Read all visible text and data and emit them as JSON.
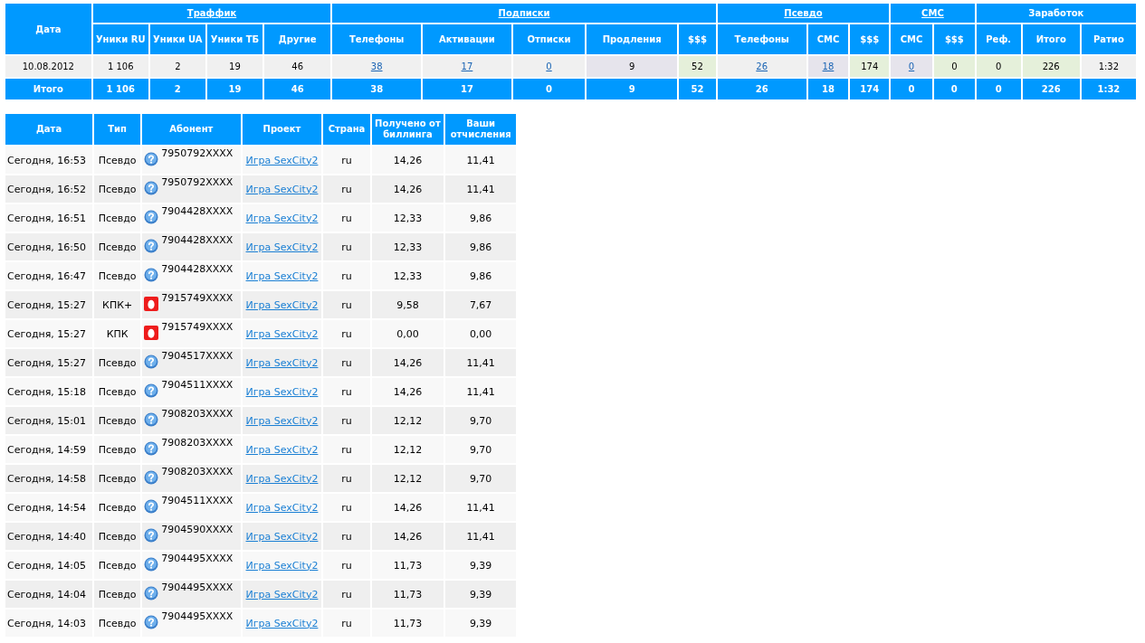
{
  "summary": {
    "groups": [
      {
        "label": "Дата",
        "link": false
      },
      {
        "label": "Траффик",
        "link": true,
        "columns": [
          "Уники RU",
          "Уники UA",
          "Уники ТБ",
          "Другие"
        ]
      },
      {
        "label": "Подписки",
        "link": true,
        "columns": [
          "Телефоны",
          "Активации",
          "Отписки",
          "Продления",
          "$$$"
        ]
      },
      {
        "label": "Псевдо",
        "link": true,
        "columns": [
          "Телефоны",
          "СМС",
          "$$$"
        ]
      },
      {
        "label": "СМС",
        "link": true,
        "columns": [
          "СМС",
          "$$$"
        ]
      },
      {
        "label": "Заработок",
        "link": false,
        "columns": [
          "Реф.",
          "Итого",
          "Ратио"
        ]
      }
    ],
    "row": [
      {
        "value": "10.08.2012",
        "link": false,
        "color": "#f0f0f0"
      },
      {
        "value": "1 106",
        "link": false,
        "color": "#f0f0f0"
      },
      {
        "value": "2",
        "link": false,
        "color": "#f0f0f0"
      },
      {
        "value": "19",
        "link": false,
        "color": "#f0f0f0"
      },
      {
        "value": "46",
        "link": false,
        "color": "#f0f0f0"
      },
      {
        "value": "38",
        "link": true,
        "color": "#f0f0f0"
      },
      {
        "value": "17",
        "link": true,
        "color": "#f0f0f0"
      },
      {
        "value": "0",
        "link": true,
        "color": "#f0f0f0"
      },
      {
        "value": "9",
        "link": false,
        "color": "#e6e4ec"
      },
      {
        "value": "52",
        "link": false,
        "color": "#e5f0da"
      },
      {
        "value": "26",
        "link": true,
        "color": "#f0f0f0"
      },
      {
        "value": "18",
        "link": true,
        "color": "#e6e4ec"
      },
      {
        "value": "174",
        "link": false,
        "color": "#e5f0da"
      },
      {
        "value": "0",
        "link": true,
        "color": "#e6e4ec"
      },
      {
        "value": "0",
        "link": false,
        "color": "#e5f0da"
      },
      {
        "value": "0",
        "link": false,
        "color": "#e5f0da"
      },
      {
        "value": "226",
        "link": false,
        "color": "#e5f0da"
      },
      {
        "value": "1:32",
        "link": false,
        "color": "#f0f0f0"
      }
    ],
    "total": [
      "Итого",
      "1 106",
      "2",
      "19",
      "46",
      "38",
      "17",
      "0",
      "9",
      "52",
      "26",
      "18",
      "174",
      "0",
      "0",
      "0",
      "226",
      "1:32"
    ]
  },
  "payments": {
    "columns": [
      "Дата",
      "Тип",
      "Абонент",
      "Проект",
      "Страна",
      "Получено от биллинга",
      "Ваши отчисления"
    ],
    "rows": [
      {
        "date": "Сегодня, 16:53",
        "type": "Псевдо",
        "kind": "question",
        "phone": "7950792XXXX",
        "project": "Игра SexCity2",
        "country": "ru",
        "billing": "14,26",
        "payout": "11,41"
      },
      {
        "date": "Сегодня, 16:52",
        "type": "Псевдо",
        "kind": "question",
        "phone": "7950792XXXX",
        "project": "Игра SexCity2",
        "country": "ru",
        "billing": "14,26",
        "payout": "11,41"
      },
      {
        "date": "Сегодня, 16:51",
        "type": "Псевдо",
        "kind": "question",
        "phone": "7904428XXXX",
        "project": "Игра SexCity2",
        "country": "ru",
        "billing": "12,33",
        "payout": "9,86"
      },
      {
        "date": "Сегодня, 16:50",
        "type": "Псевдо",
        "kind": "question",
        "phone": "7904428XXXX",
        "project": "Игра SexCity2",
        "country": "ru",
        "billing": "12,33",
        "payout": "9,86"
      },
      {
        "date": "Сегодня, 16:47",
        "type": "Псевдо",
        "kind": "question",
        "phone": "7904428XXXX",
        "project": "Игра SexCity2",
        "country": "ru",
        "billing": "12,33",
        "payout": "9,86"
      },
      {
        "date": "Сегодня, 15:27",
        "type": "КПК+",
        "kind": "egg",
        "phone": "7915749XXXX",
        "project": "Игра SexCity2",
        "country": "ru",
        "billing": "9,58",
        "payout": "7,67"
      },
      {
        "date": "Сегодня, 15:27",
        "type": "КПК",
        "kind": "egg",
        "phone": "7915749XXXX",
        "project": "Игра SexCity2",
        "country": "ru",
        "billing": "0,00",
        "payout": "0,00"
      },
      {
        "date": "Сегодня, 15:27",
        "type": "Псевдо",
        "kind": "question",
        "phone": "7904517XXXX",
        "project": "Игра SexCity2",
        "country": "ru",
        "billing": "14,26",
        "payout": "11,41"
      },
      {
        "date": "Сегодня, 15:18",
        "type": "Псевдо",
        "kind": "question",
        "phone": "7904511XXXX",
        "project": "Игра SexCity2",
        "country": "ru",
        "billing": "14,26",
        "payout": "11,41"
      },
      {
        "date": "Сегодня, 15:01",
        "type": "Псевдо",
        "kind": "question",
        "phone": "7908203XXXX",
        "project": "Игра SexCity2",
        "country": "ru",
        "billing": "12,12",
        "payout": "9,70"
      },
      {
        "date": "Сегодня, 14:59",
        "type": "Псевдо",
        "kind": "question",
        "phone": "7908203XXXX",
        "project": "Игра SexCity2",
        "country": "ru",
        "billing": "12,12",
        "payout": "9,70"
      },
      {
        "date": "Сегодня, 14:58",
        "type": "Псевдо",
        "kind": "question",
        "phone": "7908203XXXX",
        "project": "Игра SexCity2",
        "country": "ru",
        "billing": "12,12",
        "payout": "9,70"
      },
      {
        "date": "Сегодня, 14:54",
        "type": "Псевдо",
        "kind": "question",
        "phone": "7904511XXXX",
        "project": "Игра SexCity2",
        "country": "ru",
        "billing": "14,26",
        "payout": "11,41"
      },
      {
        "date": "Сегодня, 14:40",
        "type": "Псевдо",
        "kind": "question",
        "phone": "7904590XXXX",
        "project": "Игра SexCity2",
        "country": "ru",
        "billing": "14,26",
        "payout": "11,41"
      },
      {
        "date": "Сегодня, 14:05",
        "type": "Псевдо",
        "kind": "question",
        "phone": "7904495XXXX",
        "project": "Игра SexCity2",
        "country": "ru",
        "billing": "11,73",
        "payout": "9,39"
      },
      {
        "date": "Сегодня, 14:04",
        "type": "Псевдо",
        "kind": "question",
        "phone": "7904495XXXX",
        "project": "Игра SexCity2",
        "country": "ru",
        "billing": "11,73",
        "payout": "9,39"
      },
      {
        "date": "Сегодня, 14:03",
        "type": "Псевдо",
        "kind": "question",
        "phone": "7904495XXXX",
        "project": "Игра SexCity2",
        "country": "ru",
        "billing": "11,73",
        "payout": "9,39"
      }
    ]
  }
}
